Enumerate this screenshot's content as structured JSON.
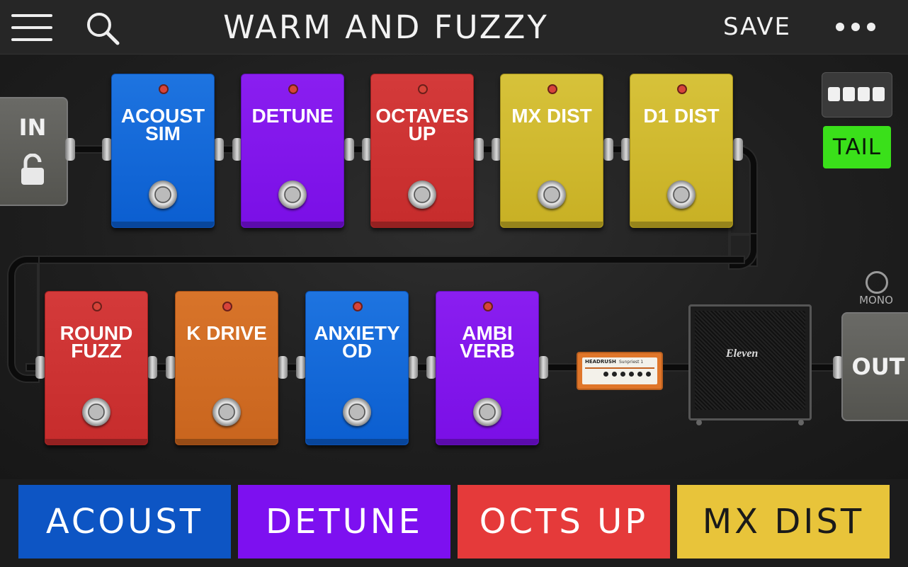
{
  "header": {
    "title": "WARM AND FUZZY",
    "save_label": "SAVE",
    "menu_icon": "hamburger-menu-icon",
    "search_icon": "search-icon",
    "more_icon": "more-options-icon"
  },
  "io": {
    "in_label": "IN",
    "out_label": "OUT",
    "lock_icon": "unlocked-padlock-icon"
  },
  "pedals_row1": [
    {
      "label": "ACOUST SIM",
      "line1": "ACOUST",
      "line2": "SIM",
      "color": "#1e74e0"
    },
    {
      "label": "DETUNE",
      "line1": "DETUNE",
      "line2": "",
      "color": "#8a1ef0"
    },
    {
      "label": "OCTAVES UP",
      "line1": "OCTAVES",
      "line2": "UP",
      "color": "#d43a3a"
    },
    {
      "label": "MX DIST",
      "line1": "MX DIST",
      "line2": "",
      "color": "#d7c23a"
    },
    {
      "label": "D1 DIST",
      "line1": "D1 DIST",
      "line2": "",
      "color": "#d7c23a"
    }
  ],
  "pedals_row2": [
    {
      "label": "ROUND FUZZ",
      "line1": "ROUND",
      "line2": "FUZZ",
      "color": "#d43a3a"
    },
    {
      "label": "K DRIVE",
      "line1": "K DRIVE",
      "line2": "",
      "color": "#d8742a"
    },
    {
      "label": "ANXIETY OD",
      "line1": "ANXIETY",
      "line2": "OD",
      "color": "#1e74e0"
    },
    {
      "label": "AMBI VERB",
      "line1": "AMBI",
      "line2": "VERB",
      "color": "#8a1ef0"
    }
  ],
  "side_controls": {
    "tail_label": "TAIL",
    "tail_color": "#3ae01a",
    "mono_label": "MONO",
    "layout_icon": "footswitch-layout-icon"
  },
  "amp": {
    "brand": "HEADRUSH",
    "model": "Sunpriest 1"
  },
  "cab": {
    "logo": "Eleven"
  },
  "footswitches": [
    {
      "label": "ACOUST",
      "color": "#0d55c4",
      "text_color": "#ffffff"
    },
    {
      "label": "DETUNE",
      "color": "#7d10f0",
      "text_color": "#ffffff"
    },
    {
      "label": "OCTS UP",
      "color": "#e53a3a",
      "text_color": "#ffffff"
    },
    {
      "label": "MX DIST",
      "color": "#e8c43a",
      "text_color": "#1a1a1a"
    }
  ]
}
